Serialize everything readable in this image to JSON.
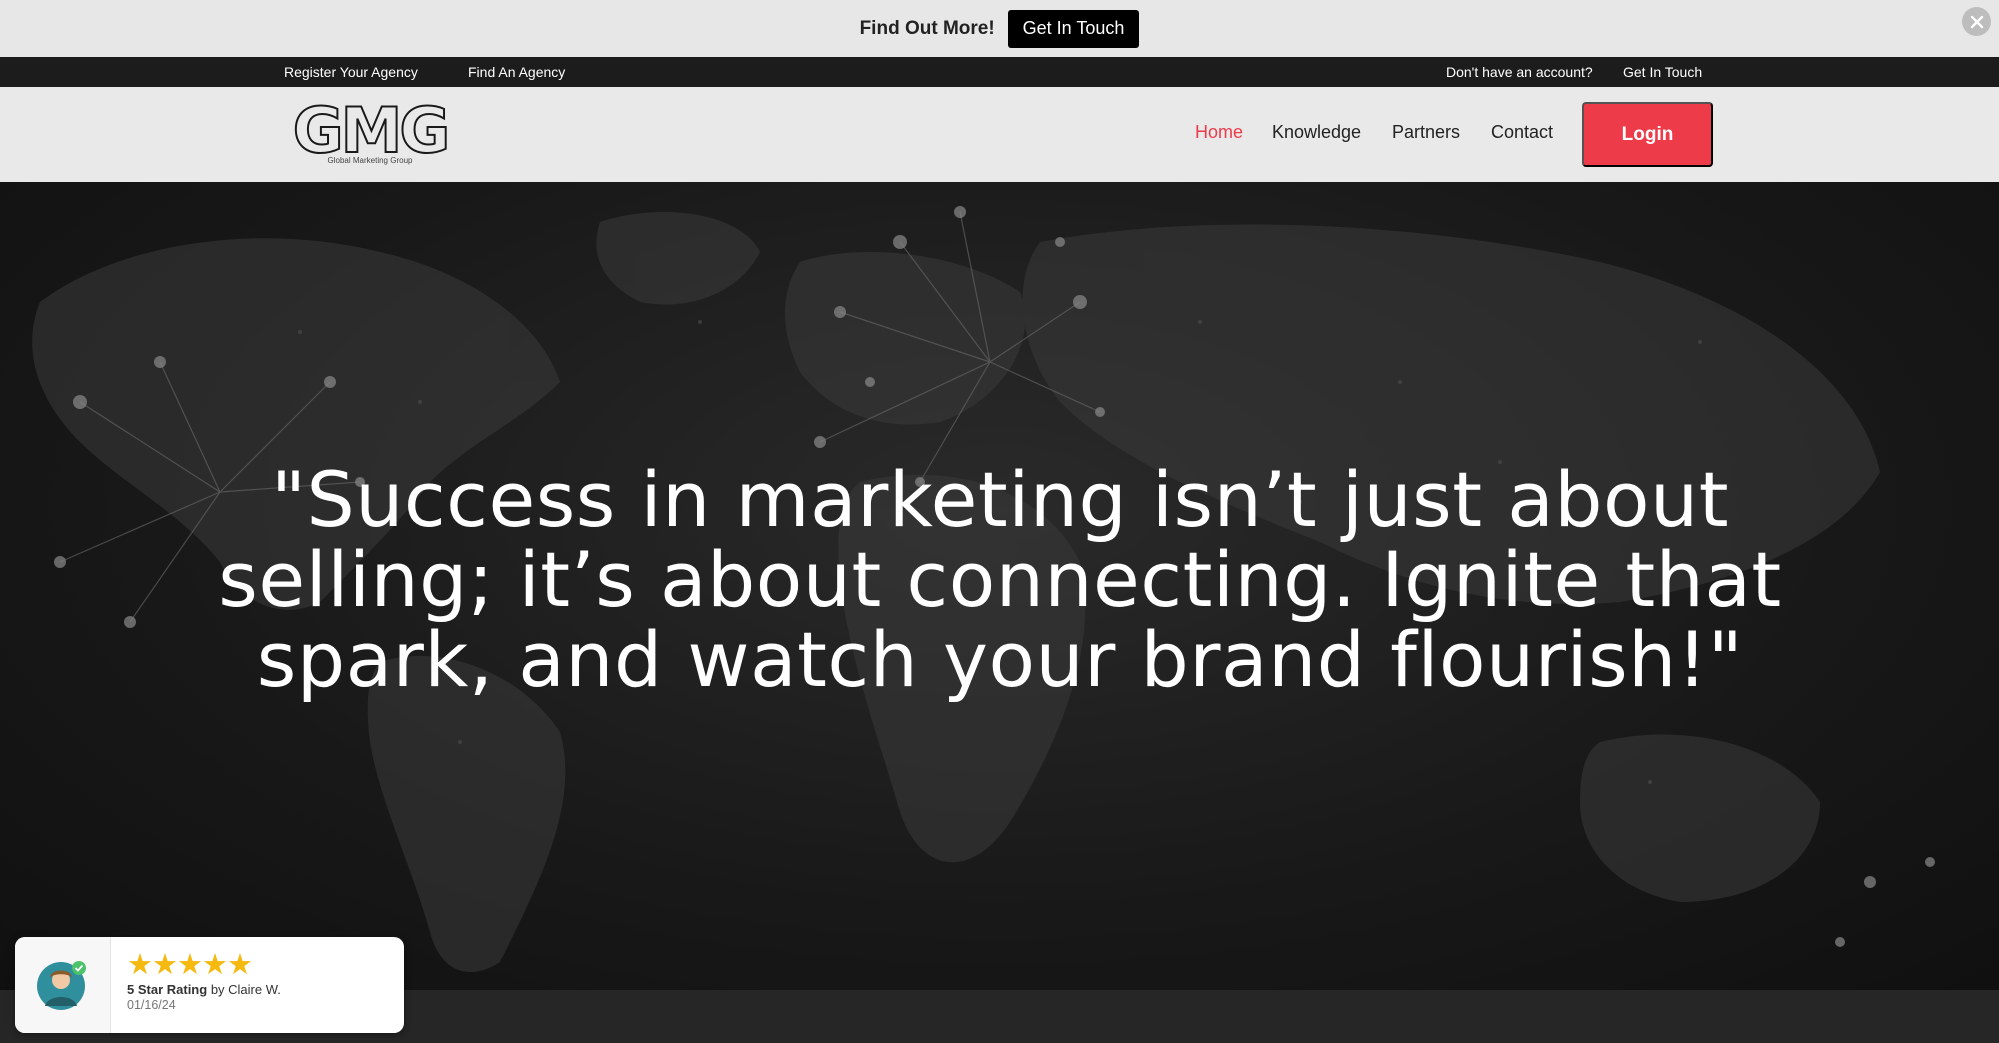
{
  "announcement": {
    "text": "Find Out More!",
    "cta_label": "Get In Touch"
  },
  "utility_bar": {
    "left_links": [
      "Register Your Agency",
      "Find An Agency"
    ],
    "right_text": "Don't have an account?",
    "right_link": "Get In Touch"
  },
  "header": {
    "logo_text": "GMG",
    "logo_tagline": "Global Marketing Group",
    "nav": [
      {
        "label": "Home",
        "active": true
      },
      {
        "label": "Knowledge",
        "active": false
      },
      {
        "label": "Partners",
        "active": false
      },
      {
        "label": "Contact",
        "active": false
      }
    ],
    "login_label": "Login"
  },
  "hero": {
    "quote_line1": "\"Success in marketing isn’t just about",
    "quote_line2": "selling; it’s about connecting. Ignite that",
    "quote_line3": "spark, and watch your brand flourish!\""
  },
  "review": {
    "stars": "★★★★★",
    "rating_label": "5 Star Rating",
    "by_text": "by Claire W.",
    "date": "01/16/24"
  },
  "colors": {
    "accent": "#ee3b4a",
    "announce_bg": "#e7e7e7",
    "utility_bg": "#1c1c1c",
    "header_bg": "#e9e9e9",
    "star": "#f5b90f"
  }
}
